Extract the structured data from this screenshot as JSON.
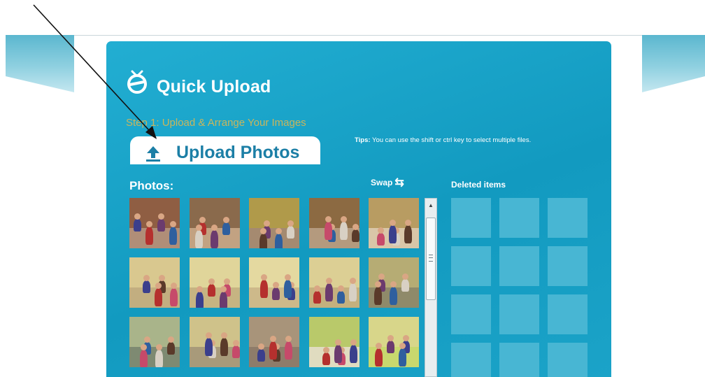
{
  "header": {
    "brand": "Quick Upload"
  },
  "step": {
    "label": "Step 1: Upload & Arrange Your Images"
  },
  "upload": {
    "label": "Upload Photos",
    "icon": "upload-arrow-icon"
  },
  "tips": {
    "prefix": "Tips:",
    "text": " You can use the shift or ctrl key to select multiple files."
  },
  "photos": {
    "heading": "Photos:",
    "items": [
      {
        "name": "photo-1",
        "wall": "#8f5e43",
        "floor": "#b08e78"
      },
      {
        "name": "photo-2",
        "wall": "#8a6a4c",
        "floor": "#c2a282"
      },
      {
        "name": "photo-3",
        "wall": "#b09a4a",
        "floor": "#a58a70"
      },
      {
        "name": "photo-4",
        "wall": "#8c6a42",
        "floor": "#b49a7e"
      },
      {
        "name": "photo-5",
        "wall": "#b89c62",
        "floor": "#d9c6a8"
      },
      {
        "name": "photo-6",
        "wall": "#d9c88f",
        "floor": "#c2ae80"
      },
      {
        "name": "photo-7",
        "wall": "#e0d59a",
        "floor": "#c6b482"
      },
      {
        "name": "photo-8",
        "wall": "#e4d9a0",
        "floor": "#cdb98a"
      },
      {
        "name": "photo-9",
        "wall": "#dccf94",
        "floor": "#c4b07e"
      },
      {
        "name": "photo-10",
        "wall": "#b6ac74",
        "floor": "#8f8a6a"
      },
      {
        "name": "photo-11",
        "wall": "#a9b48a",
        "floor": "#7e8a72"
      },
      {
        "name": "photo-12",
        "wall": "#cfc28a",
        "floor": "#a89a7a"
      },
      {
        "name": "photo-13",
        "wall": "#a8947a",
        "floor": "#8e7c6a"
      },
      {
        "name": "photo-14",
        "wall": "#b9c96a",
        "floor": "#e0dcc0"
      },
      {
        "name": "photo-15",
        "wall": "#d8d68a",
        "floor": "#c8d86e"
      }
    ]
  },
  "swap": {
    "label": "Swap",
    "icon": "swap-arrows-icon"
  },
  "deleted": {
    "heading": "Deleted items",
    "slots": 12
  },
  "colors": {
    "panel": "#1ba3c8",
    "slot": "#48b6d3",
    "step_text": "#e7b94a",
    "upload_text": "#1c7fa6"
  }
}
